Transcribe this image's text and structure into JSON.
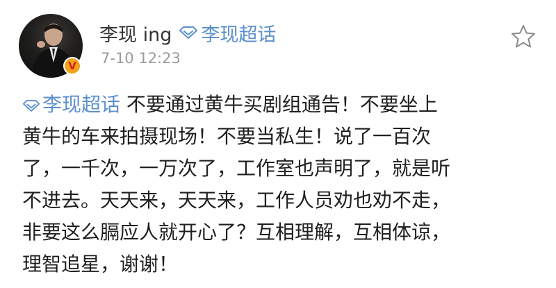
{
  "post": {
    "username": "李现 ing",
    "topic_tag": "李现超话",
    "timestamp": "7-10 12:23",
    "verified_badge": "V",
    "body_topic": "李现超话",
    "body_lines": [
      " 不要通过黄牛买剧组通告！不要坐上",
      "黄牛的车来拍摄现场！不要当私生！说了一百次",
      "了，一千次，一万次了，工作室也声明了，就是听",
      "不进去。天天来，天天来，工作人员劝也劝不走，",
      "非要这么膈应人就开心了？互相理解，互相体谅，",
      "理智追星，谢谢！"
    ]
  },
  "icons": {
    "topic": "super-topic-diamond-icon",
    "favorite": "star-outline-icon",
    "verified": "verified-v-badge-icon"
  },
  "colors": {
    "link": "#5b8fcd",
    "timestamp": "#9a9a9a",
    "badge": "#f2a31b",
    "badge_text": "#d6231a",
    "text": "#1f1f1f"
  }
}
